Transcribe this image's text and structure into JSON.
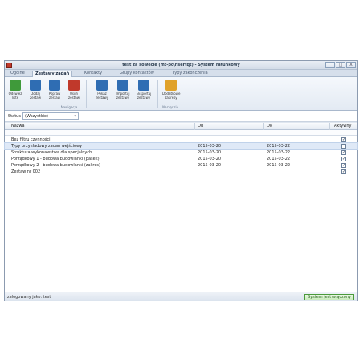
{
  "window": {
    "title": "test za sowecie (mt-pc\\nsertqt) - System ratunkowy",
    "controls": [
      "_",
      "□",
      "X"
    ]
  },
  "tabs": [
    {
      "label": "Ogólne"
    },
    {
      "label": "Zestawy zadań"
    },
    {
      "label": "Kontakty"
    },
    {
      "label": "Grupy kontaktów"
    },
    {
      "label": "Typy zakończenia"
    }
  ],
  "ribbon": {
    "buttons": [
      {
        "label": "Odśwież listę",
        "color": "#3f9a3a"
      },
      {
        "label": "Dodaj zestaw",
        "color": "#2f6db3"
      },
      {
        "label": "Popraw zestaw",
        "color": "#2f6db3"
      },
      {
        "label": "Usuń zestaw",
        "color": "#c0392b"
      },
      {
        "label": "Pokaż zestawy",
        "color": "#2f6db3"
      },
      {
        "label": "Importuj zestawy",
        "color": "#2f6db3"
      },
      {
        "label": "Eksportuj zestawy",
        "color": "#2f6db3"
      },
      {
        "label": "Dodatkowe zakresy",
        "color": "#e0a22a"
      }
    ],
    "groups": [
      "Nawigacja",
      "Narzędzia..."
    ]
  },
  "filter": {
    "label": "Status",
    "value": "(Wszystkie)"
  },
  "grid": {
    "columns": [
      "Nazwa",
      "Od",
      "Do",
      "Aktywny"
    ],
    "rows": [
      {
        "name": "Bez filtru czynności",
        "from": "",
        "to": "",
        "active": true
      },
      {
        "name": "Typy przykładowy zadań wejściowy",
        "from": "2015-03-20",
        "to": "2015-03-22",
        "active": false,
        "selected": true
      },
      {
        "name": "Struktura wykonawstwa dla specjalnych",
        "from": "2015-03-20",
        "to": "2015-03-22",
        "active": true
      },
      {
        "name": "Porządkowy 1 - budowa budowlanki (pasek)",
        "from": "2015-03-20",
        "to": "2015-03-22",
        "active": true
      },
      {
        "name": "Porządkowy 2 - budowa budowlanki (zakres)",
        "from": "2015-03-20",
        "to": "2015-03-22",
        "active": true
      },
      {
        "name": "Zestaw nr 002",
        "from": "",
        "to": "",
        "active": true
      }
    ]
  },
  "status": {
    "user": "zalogowany jako: test",
    "state": "System jest włączony"
  }
}
